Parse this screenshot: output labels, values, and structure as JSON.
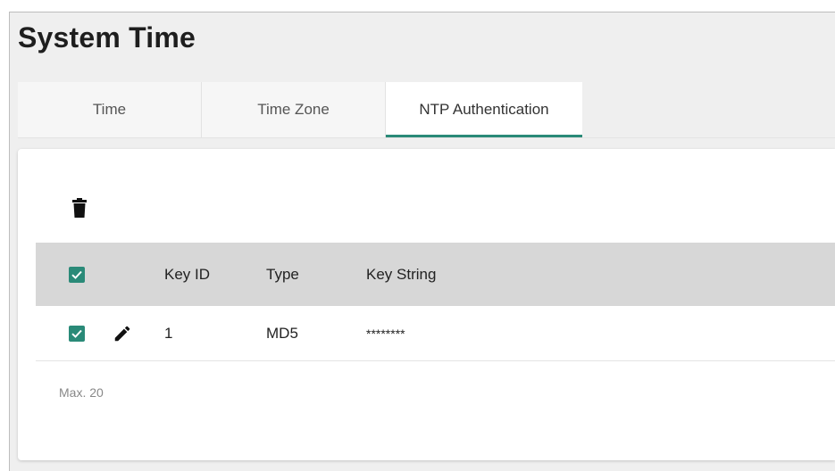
{
  "page": {
    "title": "System Time"
  },
  "tabs": [
    {
      "label": "Time",
      "active": false
    },
    {
      "label": "Time Zone",
      "active": false
    },
    {
      "label": "NTP Authentication",
      "active": true
    }
  ],
  "toolbar": {
    "delete_icon": "trash-icon"
  },
  "table": {
    "columns": [
      "Key ID",
      "Type",
      "Key String"
    ],
    "header_checked": true,
    "rows": [
      {
        "checked": true,
        "edit_icon": "pencil-icon",
        "key_id": "1",
        "type": "MD5",
        "key_string": "********"
      }
    ]
  },
  "footer": {
    "max_note": "Max. 20"
  },
  "colors": {
    "accent": "#2a8a78",
    "header_bg": "#d7d7d7",
    "page_bg": "#efefef"
  }
}
